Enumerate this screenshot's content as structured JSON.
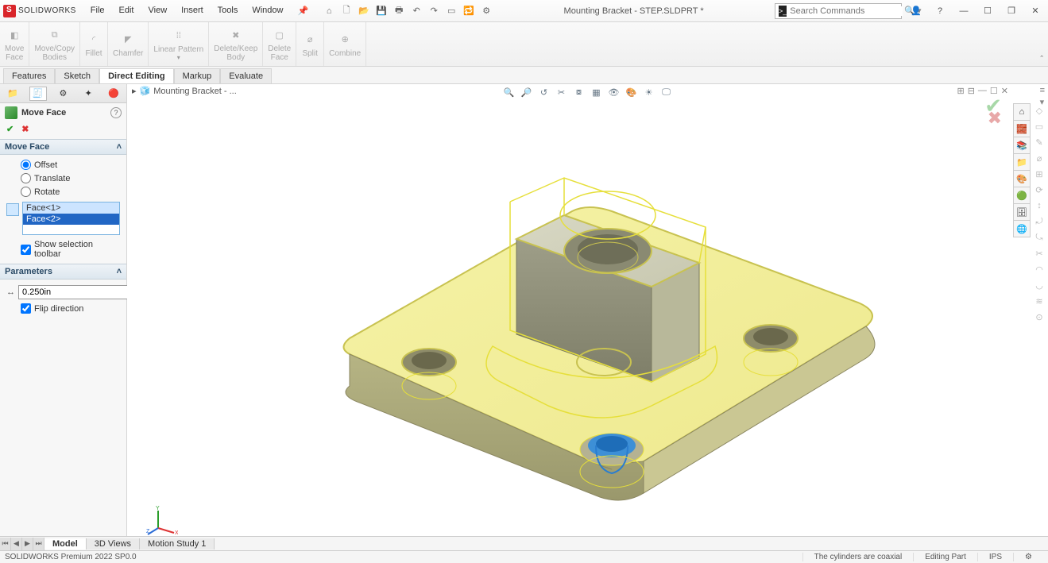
{
  "app": {
    "brand": "SOLIDWORKS",
    "title": "Mounting Bracket - STEP.SLDPRT *"
  },
  "menu": [
    "File",
    "Edit",
    "View",
    "Insert",
    "Tools",
    "Window"
  ],
  "search": {
    "placeholder": "Search Commands"
  },
  "ribbon": [
    {
      "label": "Move\nFace"
    },
    {
      "label": "Move/Copy\nBodies"
    },
    {
      "label": "Fillet"
    },
    {
      "label": "Chamfer"
    },
    {
      "label": "Linear Pattern"
    },
    {
      "label": "Delete/Keep\nBody"
    },
    {
      "label": "Delete\nFace"
    },
    {
      "label": "Split"
    },
    {
      "label": "Combine"
    }
  ],
  "main_tabs": [
    {
      "label": "Features",
      "active": false,
      "soft": true
    },
    {
      "label": "Sketch",
      "active": false,
      "soft": true
    },
    {
      "label": "Direct Editing",
      "active": true
    },
    {
      "label": "Markup",
      "active": false,
      "soft": true
    },
    {
      "label": "Evaluate",
      "active": false,
      "soft": true
    }
  ],
  "breadcrumb": "Mounting Bracket - ...",
  "pm": {
    "title": "Move Face",
    "section1": "Move Face",
    "opt_offset": "Offset",
    "opt_translate": "Translate",
    "opt_rotate": "Rotate",
    "faces": [
      "Face<1>",
      "Face<2>"
    ],
    "show_toolbar": "Show selection toolbar",
    "section2": "Parameters",
    "distance": "0.250in",
    "flip": "Flip direction"
  },
  "bottom_tabs": [
    "Model",
    "3D Views",
    "Motion Study 1"
  ],
  "status": {
    "left": "SOLIDWORKS Premium 2022 SP0.0",
    "msg": "The cylinders are coaxial",
    "mode": "Editing Part",
    "units": "IPS"
  }
}
